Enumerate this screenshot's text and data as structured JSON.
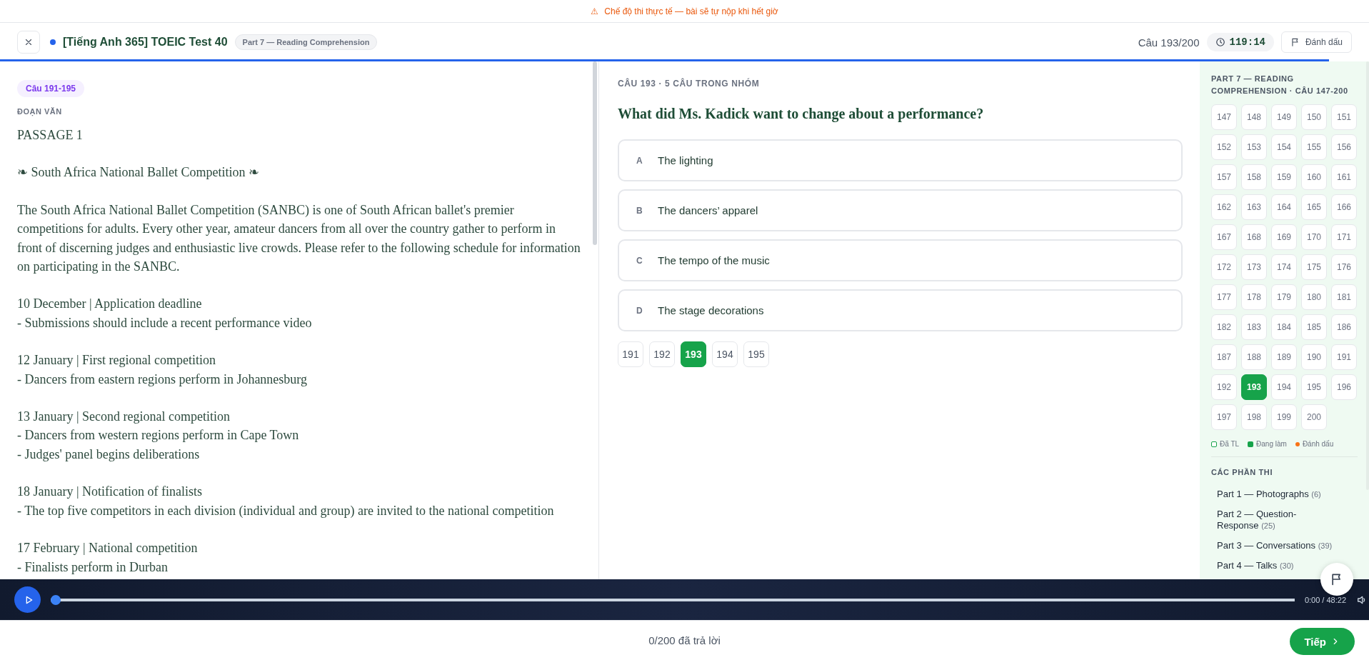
{
  "notice": {
    "icon": "⚠",
    "text": "Chế độ thi thực tế — bài sẽ tự nộp khi hết giờ"
  },
  "header": {
    "title": "[Tiếng Anh 365] TOEIC Test 40",
    "part_badge": "Part 7 — Reading Comprehension",
    "counter": "Câu 193/200",
    "timer": "119:14",
    "bookmark_button": "Đánh dấu",
    "progress": {
      "level": 0.971
    }
  },
  "passage": {
    "range_badge": "Câu 191-195",
    "label": "ĐOẠN VĂN",
    "blocks": [
      [
        "PASSAGE 1"
      ],
      [
        "❧ South Africa National Ballet Competition ❧"
      ],
      [
        "The South Africa National Ballet Competition (SANBC) is one of South African ballet's premier competitions for adults. Every other year, amateur dancers from all over the country gather to perform in front of discerning judges and enthusiastic live crowds. Please refer to the following schedule for information on participating in the SANBC."
      ],
      [
        "10 December | Application deadline",
        "- Submissions should include a recent performance video"
      ],
      [
        "12 January | First regional competition",
        "- Dancers from eastern regions perform in Johannesburg"
      ],
      [
        "13 January | Second regional competition",
        "- Dancers from western regions perform in Cape Town",
        "- Judges' panel begins deliberations"
      ],
      [
        "18 January | Notification of finalists",
        "- The top five competitors in each division (individual and group) are invited to the national competition"
      ],
      [
        "17 February | National competition",
        "- Finalists perform in Durban"
      ]
    ]
  },
  "question": {
    "meta": "CÂU 193 · 5 CÂU TRONG NHÓM",
    "text": "What did Ms. Kadick want to change about a performance?",
    "options": [
      {
        "letter": "A",
        "text": "The lighting",
        "selected": false
      },
      {
        "letter": "B",
        "text": "The dancers’ apparel",
        "selected": false
      },
      {
        "letter": "C",
        "text": "The tempo of the music",
        "selected": false
      },
      {
        "letter": "D",
        "text": "The stage decorations",
        "selected": false
      }
    ],
    "group_nav": [
      {
        "label": "191",
        "selected": false
      },
      {
        "label": "192",
        "selected": false
      },
      {
        "label": "193",
        "selected": true
      },
      {
        "label": "194",
        "selected": false
      },
      {
        "label": "195",
        "selected": false
      }
    ]
  },
  "sidebar": {
    "heading": "PART 7 — READING COMPREHENSION · CÂU 147-200",
    "questions": [
      {
        "label": "147",
        "selected": false
      },
      {
        "label": "148",
        "selected": false
      },
      {
        "label": "149",
        "selected": false
      },
      {
        "label": "150",
        "selected": false
      },
      {
        "label": "151",
        "selected": false
      },
      {
        "label": "152",
        "selected": false
      },
      {
        "label": "153",
        "selected": false
      },
      {
        "label": "154",
        "selected": false
      },
      {
        "label": "155",
        "selected": false
      },
      {
        "label": "156",
        "selected": false
      },
      {
        "label": "157",
        "selected": false
      },
      {
        "label": "158",
        "selected": false
      },
      {
        "label": "159",
        "selected": false
      },
      {
        "label": "160",
        "selected": false
      },
      {
        "label": "161",
        "selected": false
      },
      {
        "label": "162",
        "selected": false
      },
      {
        "label": "163",
        "selected": false
      },
      {
        "label": "164",
        "selected": false
      },
      {
        "label": "165",
        "selected": false
      },
      {
        "label": "166",
        "selected": false
      },
      {
        "label": "167",
        "selected": false
      },
      {
        "label": "168",
        "selected": false
      },
      {
        "label": "169",
        "selected": false
      },
      {
        "label": "170",
        "selected": false
      },
      {
        "label": "171",
        "selected": false
      },
      {
        "label": "172",
        "selected": false
      },
      {
        "label": "173",
        "selected": false
      },
      {
        "label": "174",
        "selected": false
      },
      {
        "label": "175",
        "selected": false
      },
      {
        "label": "176",
        "selected": false
      },
      {
        "label": "177",
        "selected": false
      },
      {
        "label": "178",
        "selected": false
      },
      {
        "label": "179",
        "selected": false
      },
      {
        "label": "180",
        "selected": false
      },
      {
        "label": "181",
        "selected": false
      },
      {
        "label": "182",
        "selected": false
      },
      {
        "label": "183",
        "selected": false
      },
      {
        "label": "184",
        "selected": false
      },
      {
        "label": "185",
        "selected": false
      },
      {
        "label": "186",
        "selected": false
      },
      {
        "label": "187",
        "selected": false
      },
      {
        "label": "188",
        "selected": false
      },
      {
        "label": "189",
        "selected": false
      },
      {
        "label": "190",
        "selected": false
      },
      {
        "label": "191",
        "selected": false
      },
      {
        "label": "192",
        "selected": false
      },
      {
        "label": "193",
        "selected": true
      },
      {
        "label": "194",
        "selected": false
      },
      {
        "label": "195",
        "selected": false
      },
      {
        "label": "196",
        "selected": false
      },
      {
        "label": "197",
        "selected": false
      },
      {
        "label": "198",
        "selected": false
      },
      {
        "label": "199",
        "selected": false
      },
      {
        "label": "200",
        "selected": false
      }
    ],
    "legend": [
      {
        "kind": "answered",
        "label": "Đã TL"
      },
      {
        "kind": "current",
        "label": "Đang làm"
      },
      {
        "kind": "marked",
        "label": "Đánh dấu"
      }
    ],
    "sections_heading": "CÁC PHẦN THI",
    "sections": [
      {
        "name": "Part 1 — Photographs",
        "count": "(6)"
      },
      {
        "name": "Part 2 — Question-Response",
        "count": "(25)"
      },
      {
        "name": "Part 3 — Conversations",
        "count": "(39)"
      },
      {
        "name": "Part 4 — Talks",
        "count": "(30)"
      }
    ]
  },
  "audio": {
    "progress": {
      "level": 0
    },
    "time": "0:00 / 48:22"
  },
  "footer": {
    "answered": "0/200 đã trả lời",
    "next_button": "Tiếp"
  }
}
